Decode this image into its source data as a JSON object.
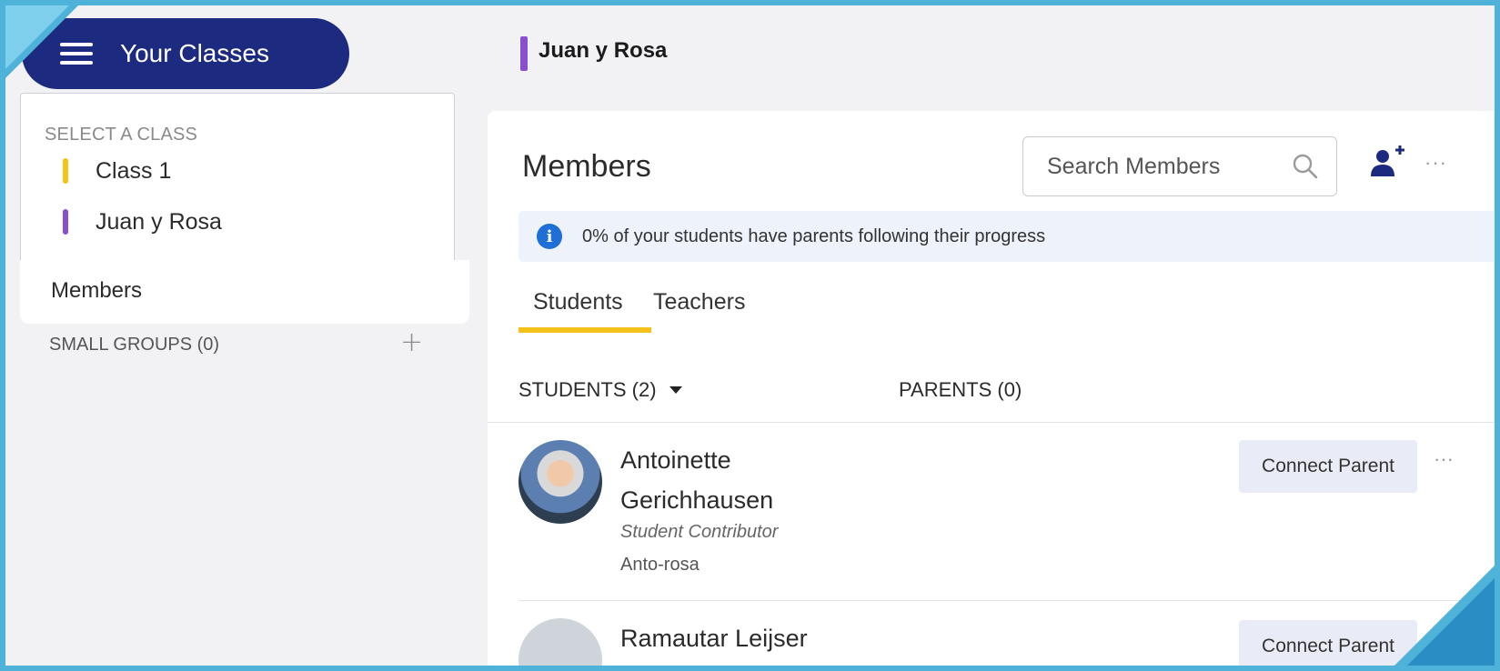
{
  "sidebar": {
    "menu_button": "Your Classes",
    "select_label": "SELECT A CLASS",
    "classes": [
      {
        "label": "Class 1",
        "color": "#f4c21a"
      },
      {
        "label": "Juan y Rosa",
        "color": "#8a4fcf"
      }
    ],
    "members_label": "Members",
    "small_groups_label": "SMALL GROUPS (0)",
    "add_group_symbol": "+"
  },
  "header": {
    "class_title": "Juan y Rosa",
    "class_color": "#8a4fcf"
  },
  "main": {
    "title": "Members",
    "search": {
      "placeholder": "Search Members"
    },
    "more_symbol": "···",
    "info_banner": "0% of your students have parents following their progress",
    "info_icon": "i",
    "tabs": [
      {
        "label": "Students",
        "active": true
      },
      {
        "label": "Teachers",
        "active": false
      }
    ],
    "columns": {
      "students": "STUDENTS (2)",
      "parents": "PARENTS (0)"
    },
    "students": [
      {
        "name": "Antoinette Gerichhausen",
        "role": "Student Contributor",
        "username": "Anto-rosa",
        "action": "Connect Parent",
        "more": "···"
      },
      {
        "name": "Ramautar Leijser",
        "action": "Connect Parent"
      }
    ]
  },
  "colors": {
    "primary_dark": "#1c2a80",
    "accent_yellow": "#f4c21a",
    "info_blue": "#1f6fd6",
    "frame_blue": "#4fb3d9"
  }
}
